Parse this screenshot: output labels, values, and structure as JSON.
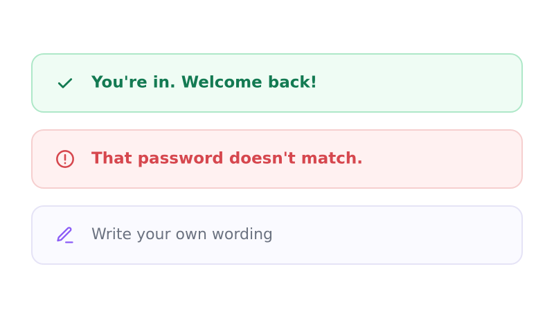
{
  "alerts": [
    {
      "type": "success",
      "icon": "check-icon",
      "message": "You're in. Welcome back!",
      "color": "#137a52",
      "background": "#effcf4",
      "border": "#aee8c8"
    },
    {
      "type": "error",
      "icon": "alert-circle-icon",
      "message": "That password doesn't match.",
      "color": "#d6474e",
      "background": "#fff1f1",
      "border": "#f6cfcf"
    },
    {
      "type": "custom",
      "icon": "pen-icon",
      "message": "Write your own wording",
      "color": "#6b7280",
      "icon_color": "#8b5cf6",
      "background": "#fafaff",
      "border": "#e5e3f6"
    }
  ]
}
